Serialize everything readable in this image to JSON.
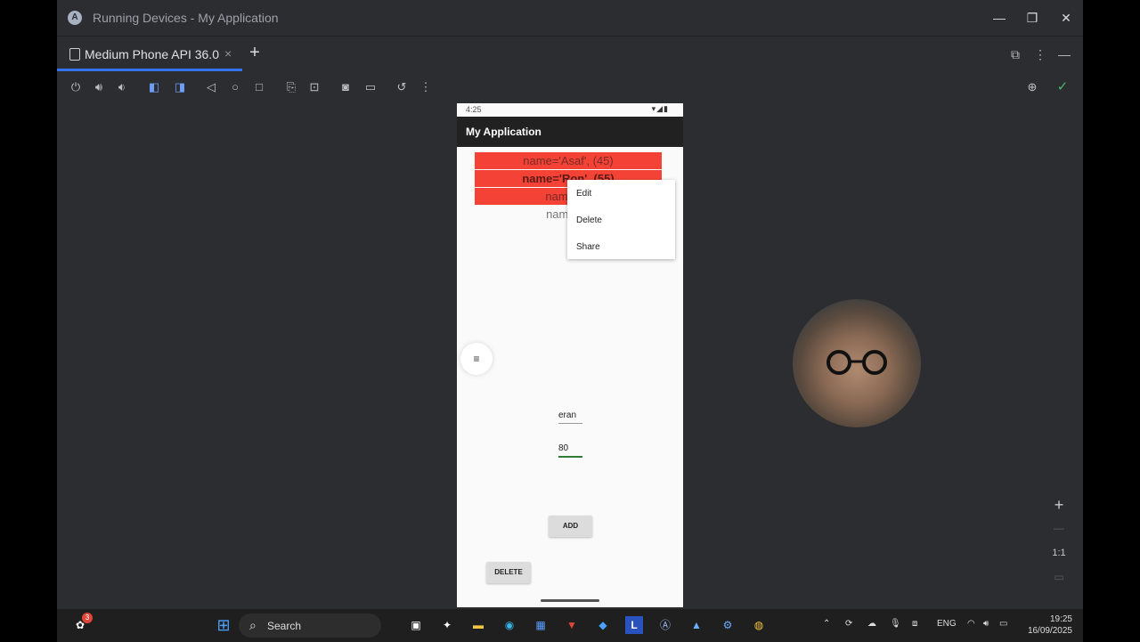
{
  "window": {
    "title": "Running Devices - My Application"
  },
  "tab": {
    "label": "Medium Phone API 36.0",
    "close": "×",
    "add": "+"
  },
  "phone": {
    "time": "4:25",
    "app_title": "My Application",
    "rows": [
      {
        "text": "name='Asaf', (45)"
      },
      {
        "text": "name='Ron', (55)"
      },
      {
        "text": "name='A"
      },
      {
        "text": "name='e"
      }
    ],
    "context_menu": [
      "Edit",
      "Delete",
      "Share"
    ],
    "name_field": "eran",
    "age_field": "80",
    "add_button": "ADD",
    "delete_button": "DELETE"
  },
  "zoom": {
    "plus": "+",
    "minus": "—",
    "ratio": "1:1"
  },
  "taskbar": {
    "search_label": "Search",
    "language": "ENG",
    "time": "19:25",
    "date": "16/09/2025",
    "badge": "3"
  },
  "icons": [
    "power-icon",
    "volume-up-icon",
    "volume-down-icon",
    "rotate-left-icon",
    "rotate-right-icon",
    "back-icon",
    "home-icon",
    "overview-icon",
    "snapshot-icon",
    "screen-record-icon",
    "camera-icon",
    "video-icon",
    "reset-icon",
    "more-icon"
  ],
  "colors": {
    "accent": "#3574f0",
    "list_red": "#f44336",
    "ide_bg": "#2b2d30",
    "check_green": "#4fb36b"
  }
}
